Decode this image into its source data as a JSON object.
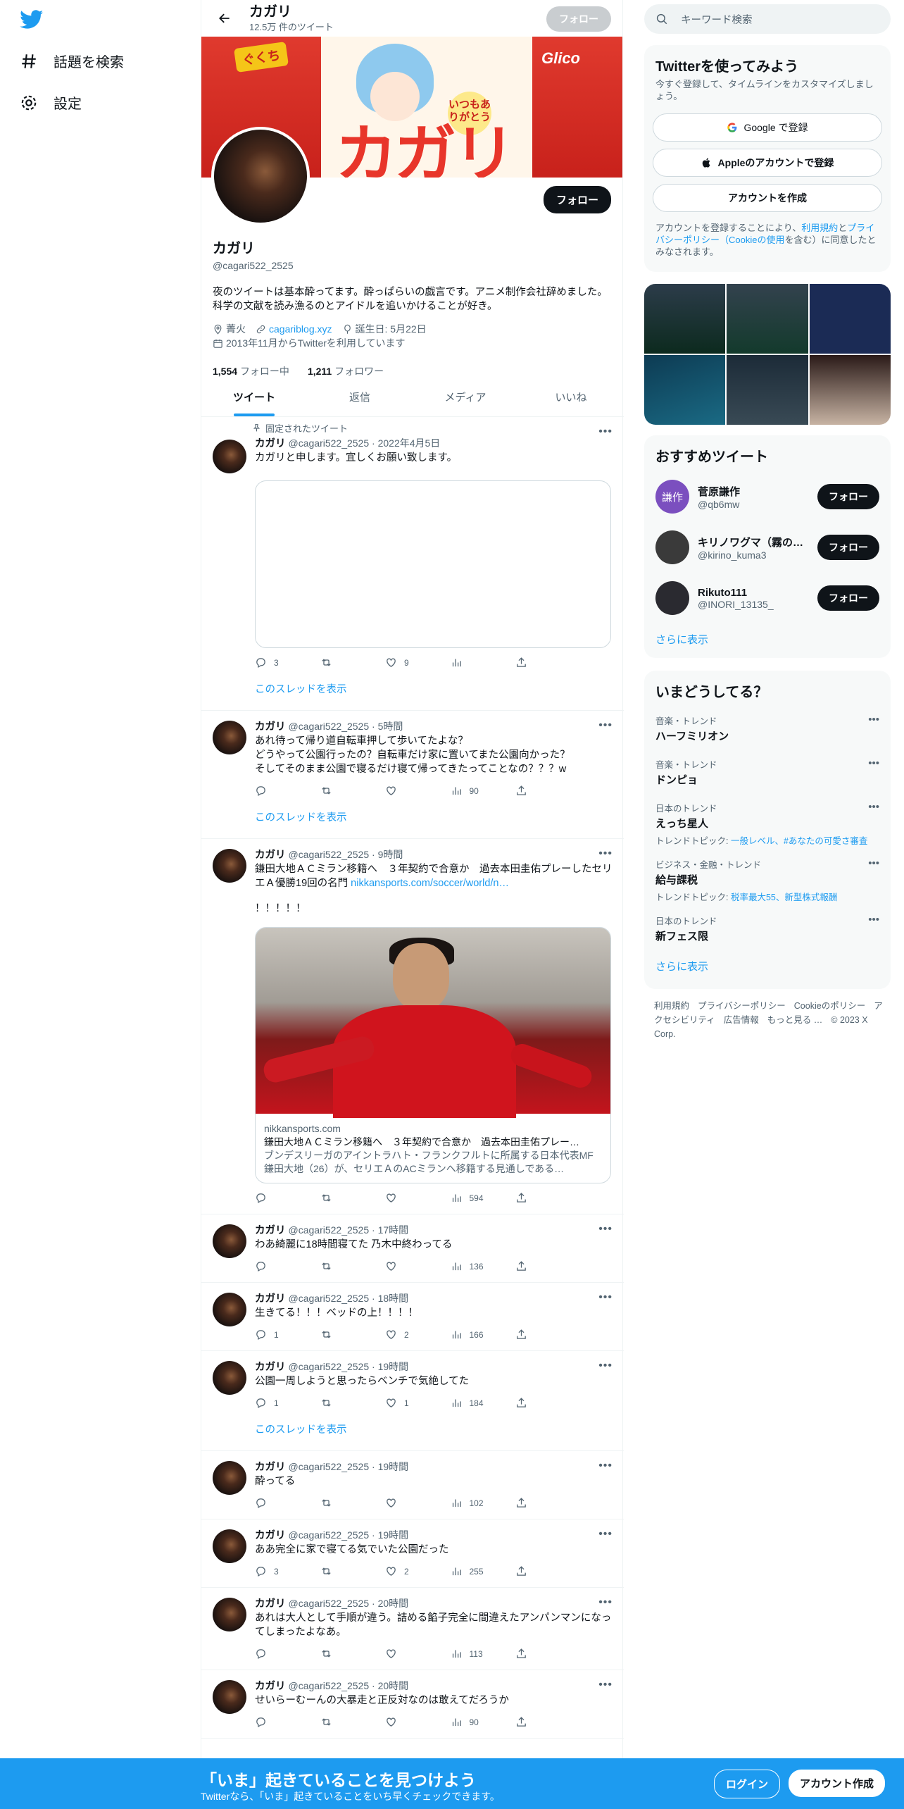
{
  "nav": {
    "explore": "話題を検索",
    "settings": "設定"
  },
  "topbar": {
    "title": "カガリ",
    "tweet_count": "12.5万 件のツイート",
    "follow": "フォロー"
  },
  "banner": {
    "tag": "ぐくち",
    "bubble": "いつもありがとう",
    "big_text": "カガリ",
    "brand": "Glico"
  },
  "profile": {
    "follow_button": "フォロー",
    "name": "カガリ",
    "handle": "@cagari522_2525",
    "bio": "夜のツイートは基本酔ってます。酔っぱらいの戯言です。アニメ制作会社辞めました。科学の文献を読み漁るのとアイドルを追いかけることが好き。",
    "location": "菁火",
    "website": "cagariblog.xyz",
    "birthday": "誕生日: 5月22日",
    "joined": "2013年11月からTwitterを利用しています",
    "following_count": "1,554",
    "following_label": "フォロー中",
    "followers_count": "1,211",
    "followers_label": "フォロワー"
  },
  "tabs": [
    "ツイート",
    "返信",
    "メディア",
    "いいね"
  ],
  "pinned_label": "固定されたツイート",
  "show_thread": "このスレッドを表示",
  "tweets": [
    {
      "name": "カガリ",
      "handle": "@cagari522_2525",
      "time": "2022年4月5日",
      "text": "カガリと申します。宜しくお願い致します。",
      "reply": "3",
      "retweet": "",
      "like": "9",
      "views": ""
    },
    {
      "name": "カガリ",
      "handle": "@cagari522_2525",
      "time": "5時間",
      "text": "あれ待って帰り道自転車押して歩いてたよな？\nどうやって公園行ったの？自転車だけ家に置いてまた公園向かった？\nそしてそのまま公園で寝るだけ寝て帰ってきたってことなの？？？w",
      "reply": "",
      "retweet": "",
      "like": "",
      "views": "90"
    },
    {
      "name": "カガリ",
      "handle": "@cagari522_2525",
      "time": "9時間",
      "text": "鎌田大地ＡＣミラン移籍へ　３年契約で合意か　過去本田圭佑プレーしたセリエＡ優勝19回の名門 ",
      "link": "nikkansports.com/soccer/world/n…",
      "text2": "！！！！！",
      "reply": "",
      "retweet": "",
      "like": "",
      "views": "594",
      "card": {
        "domain": "nikkansports.com",
        "title": "鎌田大地ＡＣミラン移籍へ　３年契約で合意か　過去本田圭佑プレー…",
        "desc": "ブンデスリーガのアイントラハト・フランクフルトに所属する日本代表MF鎌田大地（26）が、セリエＡのACミランへ移籍する見通しである…"
      }
    },
    {
      "name": "カガリ",
      "handle": "@cagari522_2525",
      "time": "17時間",
      "text": "わあ綺麗に18時間寝てた 乃木中終わってる",
      "reply": "",
      "retweet": "",
      "like": "",
      "views": "136"
    },
    {
      "name": "カガリ",
      "handle": "@cagari522_2525",
      "time": "18時間",
      "text": "生きてる！！！ベッドの上！！！！",
      "reply": "1",
      "retweet": "",
      "like": "2",
      "views": "166"
    },
    {
      "name": "カガリ",
      "handle": "@cagari522_2525",
      "time": "19時間",
      "text": "公園一周しようと思ったらベンチで気絶してた",
      "reply": "1",
      "retweet": "",
      "like": "1",
      "views": "184"
    },
    {
      "name": "カガリ",
      "handle": "@cagari522_2525",
      "time": "19時間",
      "text": "酔ってる",
      "reply": "",
      "retweet": "",
      "like": "",
      "views": "102"
    },
    {
      "name": "カガリ",
      "handle": "@cagari522_2525",
      "time": "19時間",
      "text": "ああ完全に家で寝てる気でいた公園だった",
      "reply": "3",
      "retweet": "",
      "like": "2",
      "views": "255"
    },
    {
      "name": "カガリ",
      "handle": "@cagari522_2525",
      "time": "20時間",
      "text": "あれは大人として手順が違う。詰める餡子完全に間違えたアンパンマンになってしまったよなあ。",
      "reply": "",
      "retweet": "",
      "like": "",
      "views": "113"
    },
    {
      "name": "カガリ",
      "handle": "@cagari522_2525",
      "time": "20時間",
      "text": "せいらーむーんの大暴走と正反対なのは敢えてだろうか",
      "reply": "",
      "retweet": "",
      "like": "",
      "views": "90"
    }
  ],
  "right": {
    "search_placeholder": "キーワード検索",
    "signup_title": "Twitterを使ってみよう",
    "signup_sub": "今すぐ登録して、タイムラインをカスタマイズしましょう。",
    "google": "Google で登録",
    "apple": "Appleのアカウントで登録",
    "create": "アカウントを作成",
    "terms_pre": "アカウントを登録することにより、",
    "terms_link1": "利用規約",
    "terms_mid": "と",
    "terms_link2": "プライバシーポリシー（Cookieの使用",
    "terms_post": "を含む）に同意したとみなされます。",
    "rec_title": "おすすめツイート",
    "recs": [
      {
        "name": "菅原謙作",
        "handle": "@qb6mw",
        "follow": "フォロー",
        "avatar_text": "謙作",
        "color": "#7b4fbf"
      },
      {
        "name": "キリノワグマ（霧の…",
        "handle": "@kirino_kuma3",
        "follow": "フォロー",
        "avatar_text": "",
        "color": "#3a3a3a"
      },
      {
        "name": "Rikuto111",
        "handle": "@INORI_13135_",
        "follow": "フォロー",
        "avatar_text": "",
        "color": "#2a2a30"
      }
    ],
    "show_more": "さらに表示",
    "trend_title": "いまどうしてる？",
    "trends": [
      {
        "cat": "音楽・トレンド",
        "name": "ハーフミリオン",
        "topic": ""
      },
      {
        "cat": "音楽・トレンド",
        "name": "ドンピョ",
        "topic": ""
      },
      {
        "cat": "日本のトレンド",
        "name": "えっち星人",
        "topic_pre": "トレンドトピック: ",
        "topic": "一般レベル、#あなたの可愛さ審査"
      },
      {
        "cat": "ビジネス・金融・トレンド",
        "name": "給与課税",
        "topic_pre": "トレンドトピック: ",
        "topic": "税率最大55、新型株式報酬"
      },
      {
        "cat": "日本のトレンド",
        "name": "新フェス限",
        "topic": ""
      }
    ],
    "footer": [
      "利用規約",
      "プライバシーポリシー",
      "Cookieのポリシー",
      "アクセシビリティ",
      "広告情報",
      "もっと見る …",
      "© 2023 X Corp."
    ]
  },
  "bottom": {
    "title": "「いま」起きていることを見つけよう",
    "sub": "Twitterなら、「いま」起きていることをいち早くチェックできます。",
    "login": "ログイン",
    "signup": "アカウント作成"
  },
  "colors": {
    "accent": "#1d9bf0",
    "text": "#0f1419",
    "muted": "#536471"
  }
}
